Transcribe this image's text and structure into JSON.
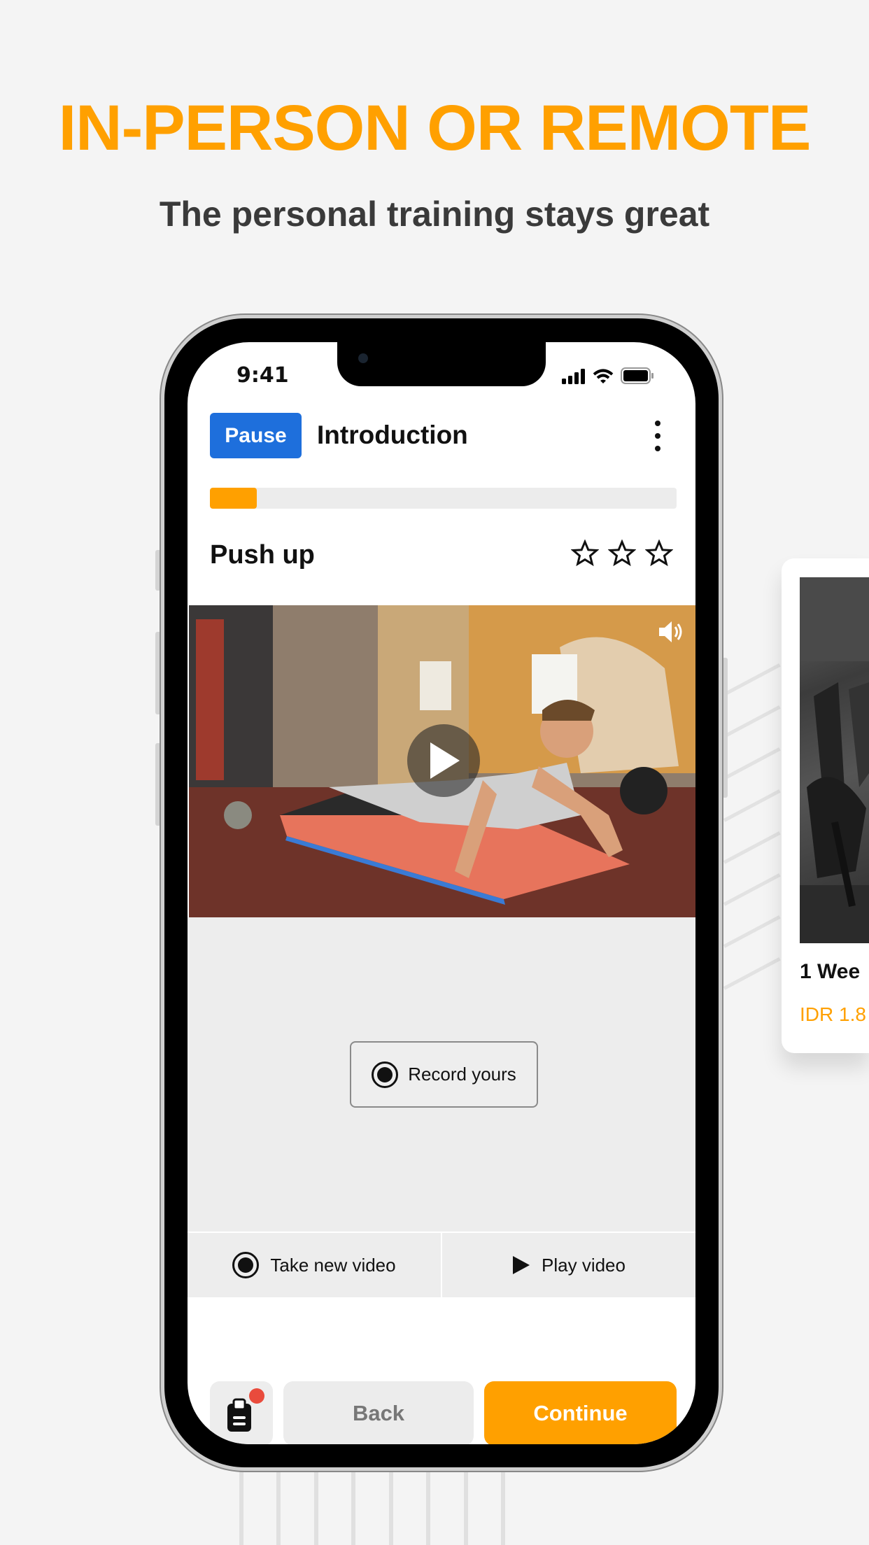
{
  "promo": {
    "headline": "IN-PERSON OR REMOTE",
    "subtitle": "The personal training stays great",
    "accent_color": "#FFA000"
  },
  "status_bar": {
    "time": "9:41",
    "icons": [
      "signal-icon",
      "wifi-icon",
      "battery-icon"
    ]
  },
  "header": {
    "pause_label": "Pause",
    "title": "Introduction",
    "menu_icon": "kebab-menu-icon",
    "pause_color": "#1E6FDC"
  },
  "progress": {
    "fraction": 0.1
  },
  "exercise": {
    "name": "Push up",
    "rating": 0,
    "max_rating": 3
  },
  "video": {
    "play_icon": "play-icon",
    "sound_icon": "speaker-icon"
  },
  "record": {
    "label": "Record yours"
  },
  "actions": {
    "take_new_label": "Take new video",
    "play_label": "Play video"
  },
  "footer": {
    "back_label": "Back",
    "continue_label": "Continue",
    "notes_icon": "clipboard-icon",
    "badge_color": "#E94B3C"
  },
  "side_card": {
    "title": "1 Wee",
    "price": "IDR 1.8"
  }
}
